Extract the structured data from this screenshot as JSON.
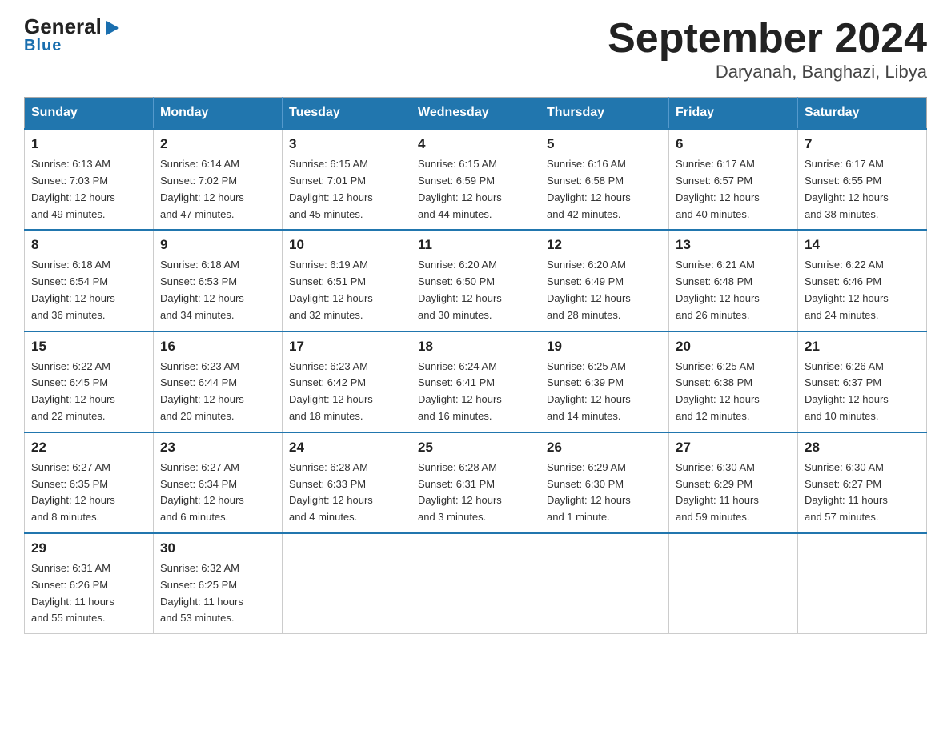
{
  "logo": {
    "general": "General",
    "blue": "Blue",
    "arrow": "▶"
  },
  "title": "September 2024",
  "subtitle": "Daryanah, Banghazi, Libya",
  "weekdays": [
    "Sunday",
    "Monday",
    "Tuesday",
    "Wednesday",
    "Thursday",
    "Friday",
    "Saturday"
  ],
  "weeks": [
    [
      {
        "day": "1",
        "sunrise": "6:13 AM",
        "sunset": "7:03 PM",
        "daylight": "12 hours and 49 minutes."
      },
      {
        "day": "2",
        "sunrise": "6:14 AM",
        "sunset": "7:02 PM",
        "daylight": "12 hours and 47 minutes."
      },
      {
        "day": "3",
        "sunrise": "6:15 AM",
        "sunset": "7:01 PM",
        "daylight": "12 hours and 45 minutes."
      },
      {
        "day": "4",
        "sunrise": "6:15 AM",
        "sunset": "6:59 PM",
        "daylight": "12 hours and 44 minutes."
      },
      {
        "day": "5",
        "sunrise": "6:16 AM",
        "sunset": "6:58 PM",
        "daylight": "12 hours and 42 minutes."
      },
      {
        "day": "6",
        "sunrise": "6:17 AM",
        "sunset": "6:57 PM",
        "daylight": "12 hours and 40 minutes."
      },
      {
        "day": "7",
        "sunrise": "6:17 AM",
        "sunset": "6:55 PM",
        "daylight": "12 hours and 38 minutes."
      }
    ],
    [
      {
        "day": "8",
        "sunrise": "6:18 AM",
        "sunset": "6:54 PM",
        "daylight": "12 hours and 36 minutes."
      },
      {
        "day": "9",
        "sunrise": "6:18 AM",
        "sunset": "6:53 PM",
        "daylight": "12 hours and 34 minutes."
      },
      {
        "day": "10",
        "sunrise": "6:19 AM",
        "sunset": "6:51 PM",
        "daylight": "12 hours and 32 minutes."
      },
      {
        "day": "11",
        "sunrise": "6:20 AM",
        "sunset": "6:50 PM",
        "daylight": "12 hours and 30 minutes."
      },
      {
        "day": "12",
        "sunrise": "6:20 AM",
        "sunset": "6:49 PM",
        "daylight": "12 hours and 28 minutes."
      },
      {
        "day": "13",
        "sunrise": "6:21 AM",
        "sunset": "6:48 PM",
        "daylight": "12 hours and 26 minutes."
      },
      {
        "day": "14",
        "sunrise": "6:22 AM",
        "sunset": "6:46 PM",
        "daylight": "12 hours and 24 minutes."
      }
    ],
    [
      {
        "day": "15",
        "sunrise": "6:22 AM",
        "sunset": "6:45 PM",
        "daylight": "12 hours and 22 minutes."
      },
      {
        "day": "16",
        "sunrise": "6:23 AM",
        "sunset": "6:44 PM",
        "daylight": "12 hours and 20 minutes."
      },
      {
        "day": "17",
        "sunrise": "6:23 AM",
        "sunset": "6:42 PM",
        "daylight": "12 hours and 18 minutes."
      },
      {
        "day": "18",
        "sunrise": "6:24 AM",
        "sunset": "6:41 PM",
        "daylight": "12 hours and 16 minutes."
      },
      {
        "day": "19",
        "sunrise": "6:25 AM",
        "sunset": "6:39 PM",
        "daylight": "12 hours and 14 minutes."
      },
      {
        "day": "20",
        "sunrise": "6:25 AM",
        "sunset": "6:38 PM",
        "daylight": "12 hours and 12 minutes."
      },
      {
        "day": "21",
        "sunrise": "6:26 AM",
        "sunset": "6:37 PM",
        "daylight": "12 hours and 10 minutes."
      }
    ],
    [
      {
        "day": "22",
        "sunrise": "6:27 AM",
        "sunset": "6:35 PM",
        "daylight": "12 hours and 8 minutes."
      },
      {
        "day": "23",
        "sunrise": "6:27 AM",
        "sunset": "6:34 PM",
        "daylight": "12 hours and 6 minutes."
      },
      {
        "day": "24",
        "sunrise": "6:28 AM",
        "sunset": "6:33 PM",
        "daylight": "12 hours and 4 minutes."
      },
      {
        "day": "25",
        "sunrise": "6:28 AM",
        "sunset": "6:31 PM",
        "daylight": "12 hours and 3 minutes."
      },
      {
        "day": "26",
        "sunrise": "6:29 AM",
        "sunset": "6:30 PM",
        "daylight": "12 hours and 1 minute."
      },
      {
        "day": "27",
        "sunrise": "6:30 AM",
        "sunset": "6:29 PM",
        "daylight": "11 hours and 59 minutes."
      },
      {
        "day": "28",
        "sunrise": "6:30 AM",
        "sunset": "6:27 PM",
        "daylight": "11 hours and 57 minutes."
      }
    ],
    [
      {
        "day": "29",
        "sunrise": "6:31 AM",
        "sunset": "6:26 PM",
        "daylight": "11 hours and 55 minutes."
      },
      {
        "day": "30",
        "sunrise": "6:32 AM",
        "sunset": "6:25 PM",
        "daylight": "11 hours and 53 minutes."
      },
      null,
      null,
      null,
      null,
      null
    ]
  ]
}
